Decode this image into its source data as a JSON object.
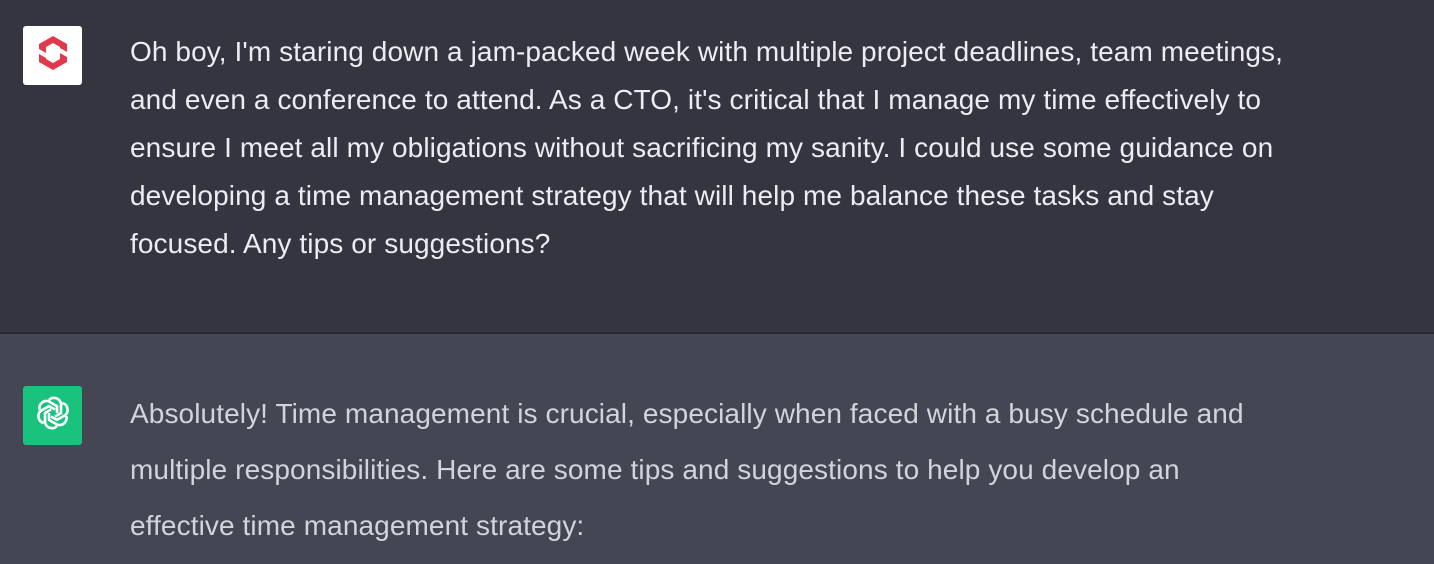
{
  "conversation": {
    "user_message": {
      "avatar_icon": "user-brand-logo-icon",
      "text": "Oh boy, I'm staring down a jam-packed week with multiple project deadlines, team meetings,\nand even a conference to attend. As a CTO, it's critical that I manage my time effectively to\nensure I meet all my obligations without sacrificing my sanity. I could use some guidance on\ndeveloping a time management strategy that will help me balance these tasks and stay\nfocused. Any tips or suggestions?"
    },
    "assistant_message": {
      "avatar_icon": "openai-logo-icon",
      "text": "Absolutely! Time management is crucial, especially when faced with a busy schedule and\nmultiple responsibilities. Here are some tips and suggestions to help you develop an\neffective time management strategy:"
    }
  },
  "colors": {
    "user_background": "#343541",
    "assistant_background": "#444654",
    "assistant_avatar": "#19c37d",
    "user_logo": "#e0394b",
    "user_text": "#ececf1",
    "assistant_text": "#d1d5db"
  }
}
